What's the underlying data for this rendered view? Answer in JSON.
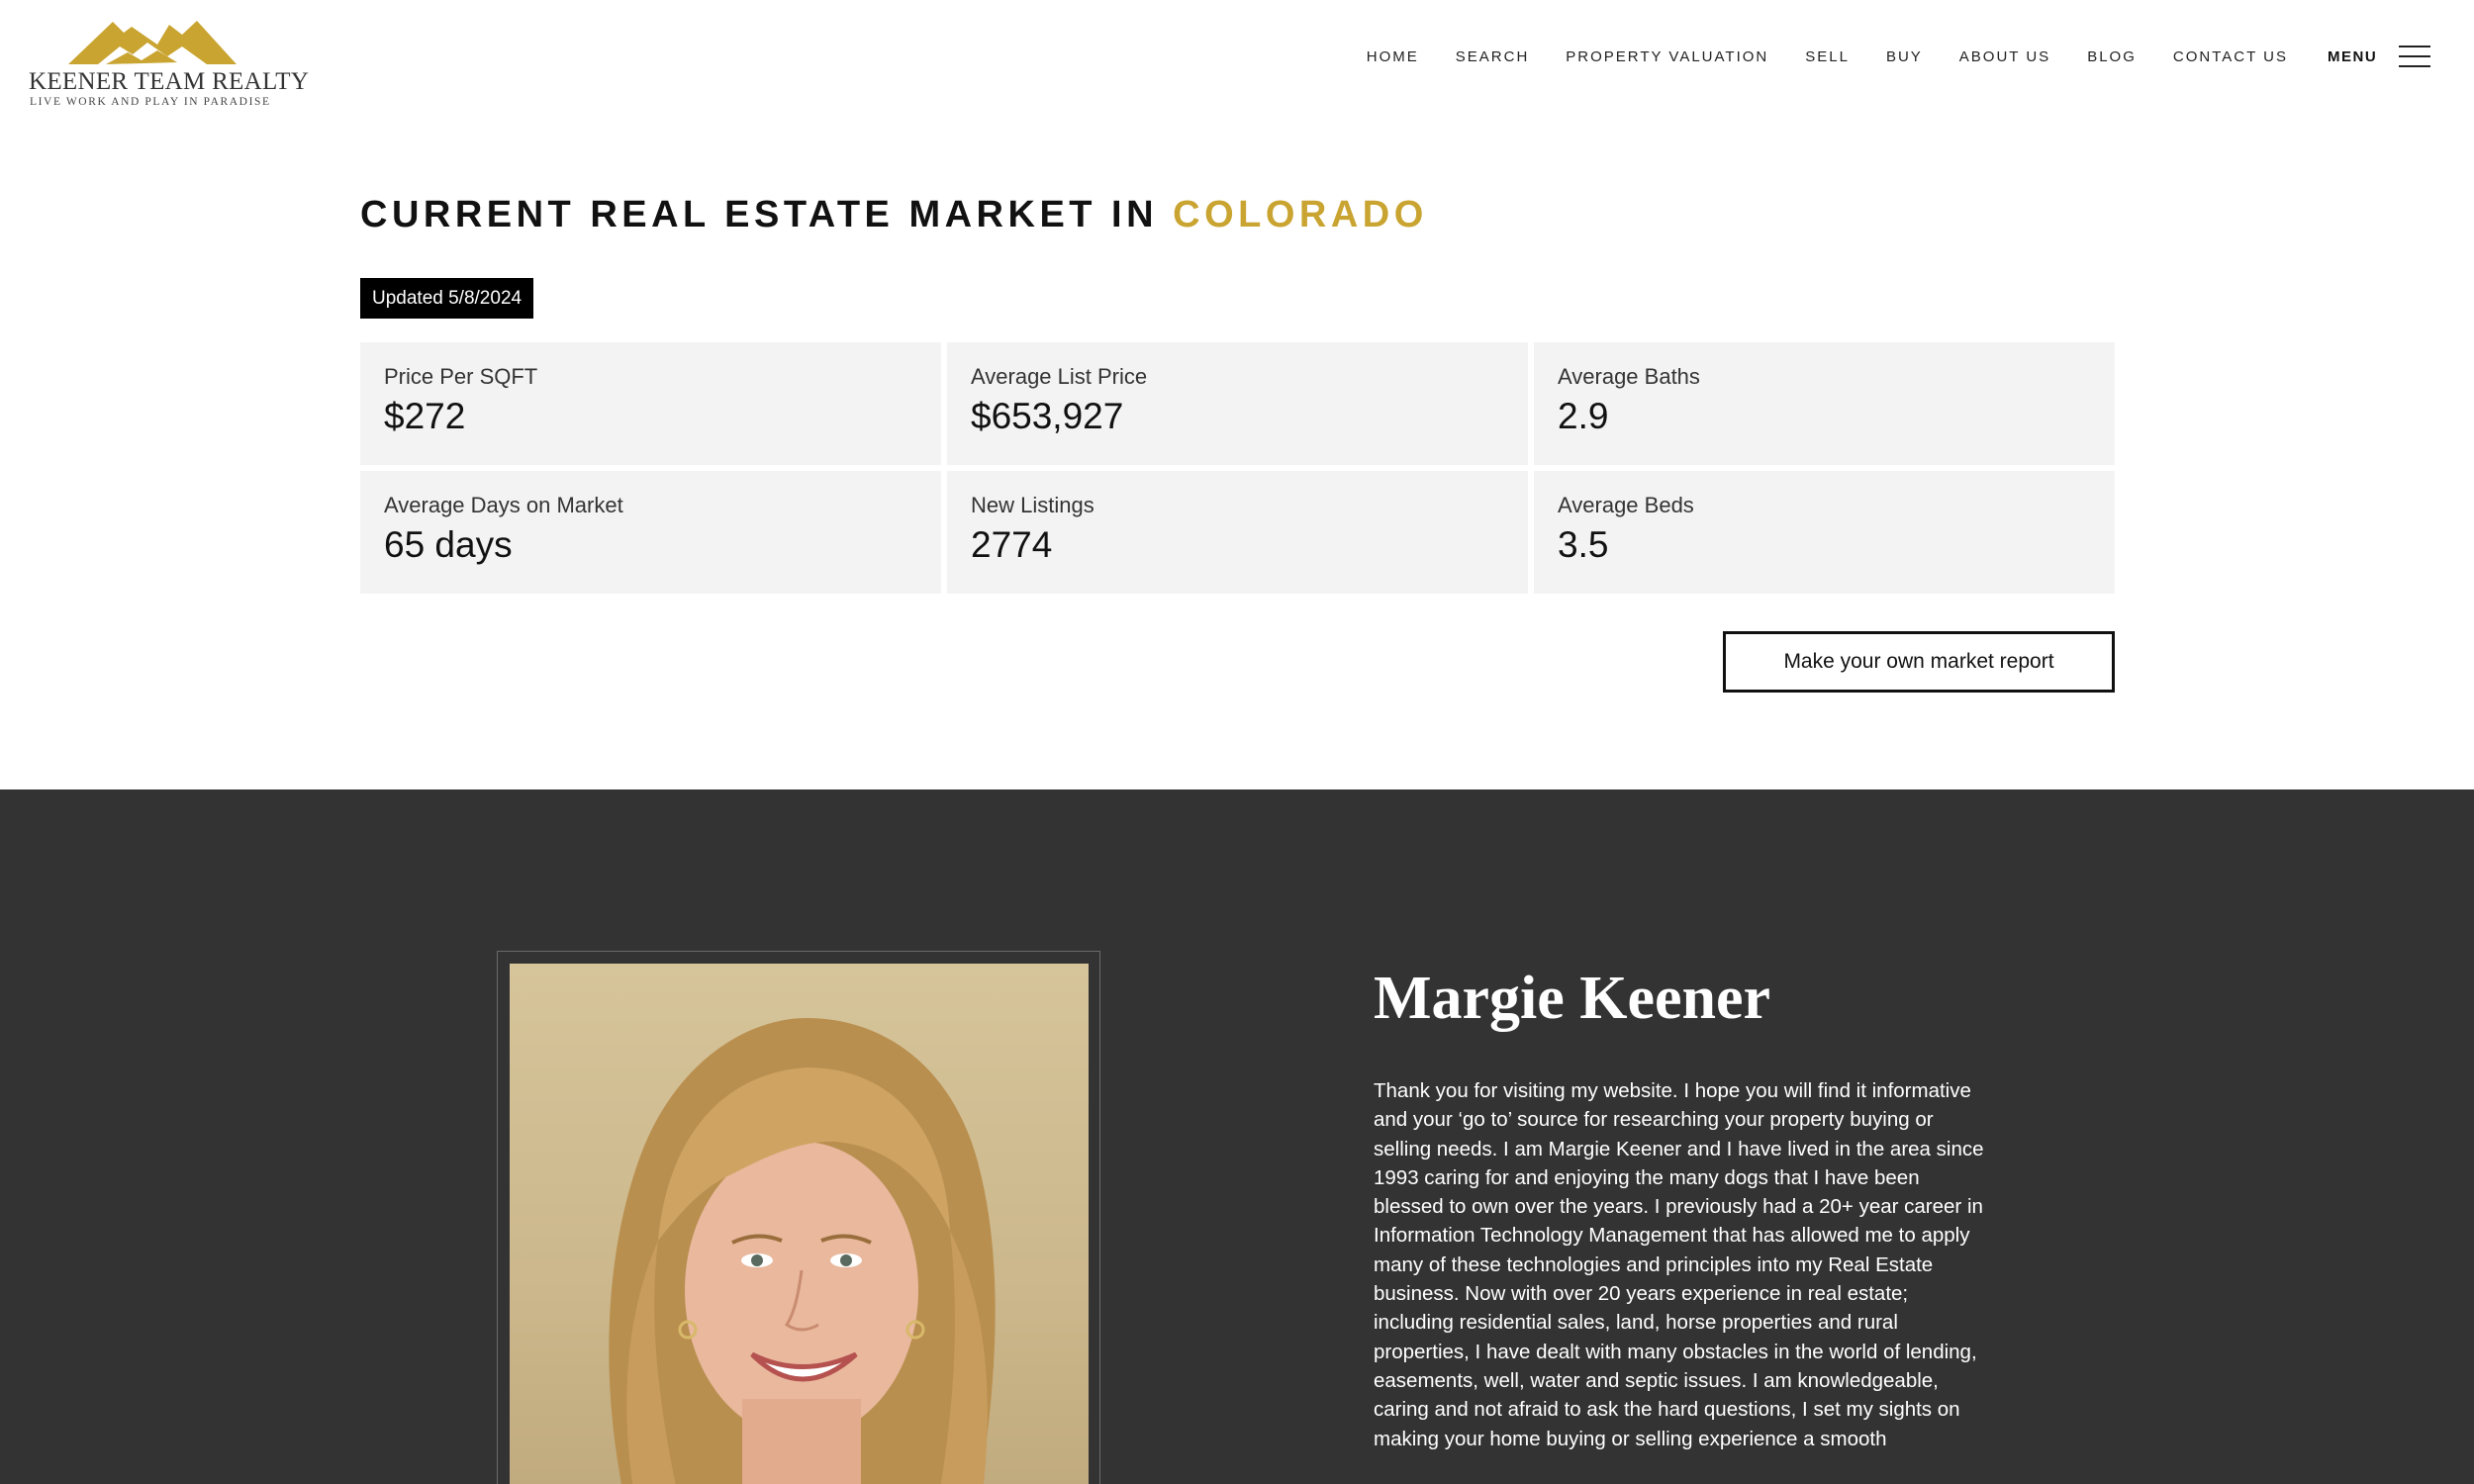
{
  "brand": {
    "name": "KEENER TEAM REALTY",
    "tagline": "LIVE WORK AND PLAY IN PARADISE",
    "gold": "#c9a431",
    "logo_icon": "mountain-logo-icon"
  },
  "nav": {
    "items": [
      {
        "label": "HOME"
      },
      {
        "label": "SEARCH"
      },
      {
        "label": "PROPERTY VALUATION"
      },
      {
        "label": "SELL"
      },
      {
        "label": "BUY"
      },
      {
        "label": "ABOUT US"
      },
      {
        "label": "BLOG"
      },
      {
        "label": "CONTACT US"
      }
    ],
    "menu_label": "MENU",
    "menu_icon": "hamburger-icon"
  },
  "market": {
    "title_prefix": "CURRENT REAL ESTATE MARKET IN",
    "title_location": "COLORADO",
    "updated": "Updated 5/8/2024",
    "stats": [
      {
        "label": "Price Per SQFT",
        "value": "$272"
      },
      {
        "label": "Average List Price",
        "value": "$653,927"
      },
      {
        "label": "Average Baths",
        "value": "2.9"
      },
      {
        "label": "Average Days on Market",
        "value": "65 days"
      },
      {
        "label": "New Listings",
        "value": "2774"
      },
      {
        "label": "Average Beds",
        "value": "3.5"
      }
    ],
    "report_button": "Make your own market report"
  },
  "agent": {
    "name": "Margie Keener",
    "bio": "Thank you for visiting my website. I hope you will find it informative and your ‘go to’ source for researching your property buying or selling needs. I am Margie Keener and I have lived in the area since 1993 caring for and enjoying the many dogs that I have been blessed to own over the years. I previously had a 20+ year career in Information Technology Management that has allowed me to apply many of these technologies and principles into my Real Estate business. Now with over 20 years experience in real estate; including residential sales, land, horse properties and rural properties, I have dealt with many obstacles in the world of lending, easements, well, water and septic issues. I am knowledgeable, caring and not afraid to ask the hard questions, I set my sights on making your home buying or selling experience a smooth"
  }
}
